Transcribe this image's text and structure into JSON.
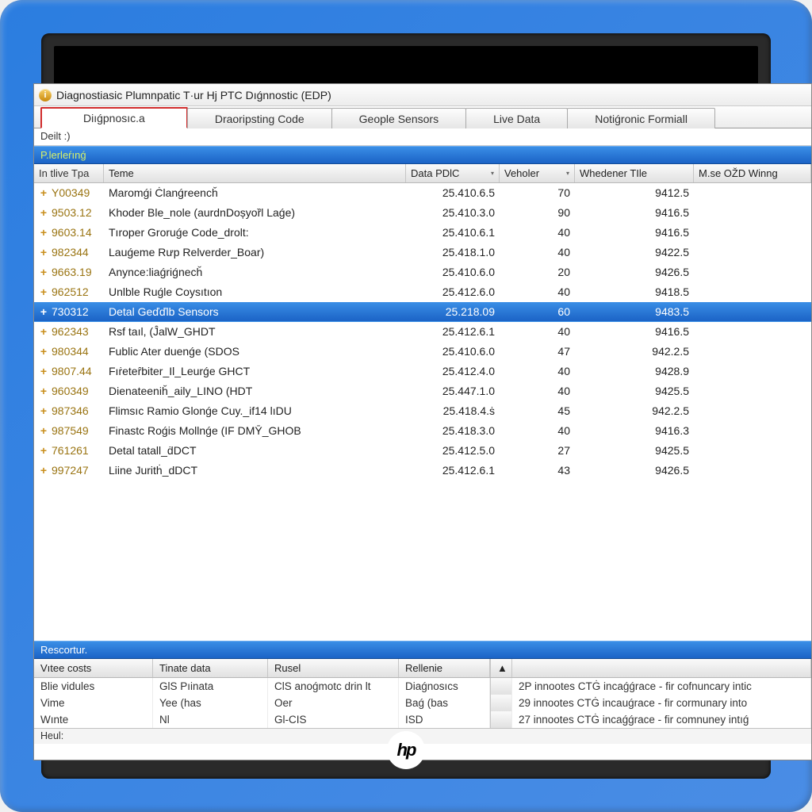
{
  "window": {
    "title": "Diagnostiasic Plumnpatic T·ur Hj PTC Dıǵnnostic (EDP)"
  },
  "tabs": [
    {
      "label": "Diıǵpnosıc.a",
      "active": true
    },
    {
      "label": "Draoripsting Code",
      "active": false
    },
    {
      "label": "Geople Sensors",
      "active": false
    },
    {
      "label": "Live Data",
      "active": false
    },
    {
      "label": "Notiǵronic Formiall",
      "active": false
    }
  ],
  "subbar": "Deilt :)",
  "section1": "P.lerleŕınǵ",
  "columns": {
    "a": "In tlive Tpa",
    "b": "Teme",
    "c": "Data PDlC",
    "d": "Veholer",
    "e": "Whedener TIle",
    "f": "M.se OŽD Winng"
  },
  "rows": [
    {
      "a": "Y00349",
      "b": "Maromǵi Ċlanǵreencȟ",
      "c": "25.410.6.5",
      "d": "70",
      "e": "9412.5",
      "f": ""
    },
    {
      "a": "9503.12",
      "b": "Khoder Ble_nole (aurdnDoșyoȑl Laǵe)",
      "c": "25.410.3.0",
      "d": "90",
      "e": "9416.5",
      "f": ""
    },
    {
      "a": "9603.14",
      "b": "Tıroper Groruǵe Code_drolt:",
      "c": "25.410.6.1",
      "d": "40",
      "e": "9416.5",
      "f": ""
    },
    {
      "a": "982344",
      "b": "Lauǵeme Rưp Relverder_Boar)",
      "c": "25.418.1.0",
      "d": "40",
      "e": "9422.5",
      "f": ""
    },
    {
      "a": "9663.19",
      "b": "Anynce:liaǵriǵnecȟ",
      "c": "25.410.6.0",
      "d": "20",
      "e": "9426.5",
      "f": ""
    },
    {
      "a": "962512",
      "b": "Unlble Ruǵle Coysıtıon",
      "c": "25.412.6.0",
      "d": "40",
      "e": "9418.5",
      "f": ""
    },
    {
      "a": "730312",
      "b": "Detal Geďďlb Sensors",
      "c": "25.218.09",
      "d": "60",
      "e": "9483.5",
      "f": "",
      "selected": true
    },
    {
      "a": "962343",
      "b": "Rsf taıl, (ĴalW_GHDT",
      "c": "25.412.6.1",
      "d": "40",
      "e": "9416.5",
      "f": ""
    },
    {
      "a": "980344",
      "b": "Fublic Ater duenǵe (SDOS",
      "c": "25.410.6.0",
      "d": "47",
      "e": "942.2.5",
      "f": ""
    },
    {
      "a": "9807.44",
      "b": "Fıṙeteȓbiter_Il_Leurǵe GHCT",
      "c": "25.412.4.0",
      "d": "40",
      "e": "9428.9",
      "f": ""
    },
    {
      "a": "960349",
      "b": "Dienateeniȟ_aily_LINO (HDT",
      "c": "25.447.1.0",
      "d": "40",
      "e": "9425.5",
      "f": ""
    },
    {
      "a": "987346",
      "b": "Flimsıc Ramio Glonǵe Cuy._if14 lıDU",
      "c": "25.418.4.ṡ",
      "d": "45",
      "e": "942.2.5",
      "f": ""
    },
    {
      "a": "987549",
      "b": "Finastc Roǵis Mollnǵe (IF DMȲ_GHOB",
      "c": "25.418.3.0",
      "d": "40",
      "e": "9416.3",
      "f": ""
    },
    {
      "a": "761261",
      "b": "Detal tatall_ḋDCT",
      "c": "25.412.5.0",
      "d": "27",
      "e": "9425.5",
      "f": ""
    },
    {
      "a": "997247",
      "b": "Liine Juritḣ_dDCT",
      "c": "25.412.6.1",
      "d": "43",
      "e": "9426.5",
      "f": ""
    }
  ],
  "section2": "Rescortur.",
  "bcols": {
    "c1": "Vıtee costs",
    "c2": "Tinate data",
    "c3": "Rusel",
    "c4": "Rellenie"
  },
  "brows": [
    {
      "c1": "Blie vidules",
      "c2": "GlS Pıinata",
      "c3": "ClS anoǵmotc drin lt",
      "c4": "Diaǵnosıcs",
      "c6": "2P innootes CTĠ incaǵǵrace - fir cofnuncary intic",
      "link": true
    },
    {
      "c1": "Vime",
      "c2": "Yee (has",
      "c3": "Oer",
      "c4": "Baǵ (bas",
      "c6": "29 innootes CTĠ incauǵrace - fir cormunary into"
    },
    {
      "c1": "Wınte",
      "c2": "Nl",
      "c3": "Gl-CIS",
      "c4": "ISD",
      "c6": "27 innootes CTĠ incaǵǵrace - fir comnuney intıǵ"
    }
  ],
  "scrollhint": "▲",
  "status": "Heul:",
  "logo": "hp"
}
